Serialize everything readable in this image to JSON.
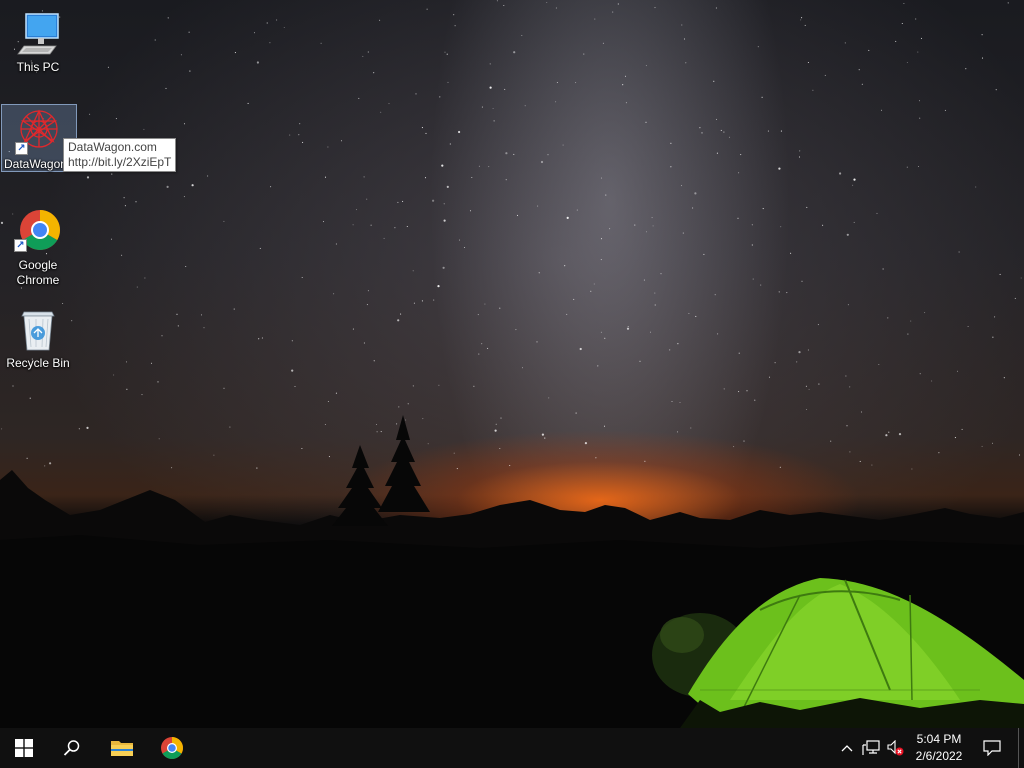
{
  "desktop": {
    "icons": [
      {
        "label": "This PC",
        "icon": "this-pc-icon"
      },
      {
        "label": "DataWagon",
        "icon": "datawagon-icon"
      },
      {
        "label": "Google Chrome",
        "icon": "chrome-icon"
      },
      {
        "label": "Recycle Bin",
        "icon": "recycle-bin-icon"
      }
    ],
    "tooltip": {
      "line1": "DataWagon.com",
      "line2": "http://bit.ly/2XziEpT"
    }
  },
  "taskbar": {
    "items": [
      {
        "name": "start",
        "icon": "windows-logo-icon"
      },
      {
        "name": "search",
        "icon": "search-icon"
      },
      {
        "name": "file-explorer",
        "icon": "folder-icon"
      },
      {
        "name": "chrome",
        "icon": "chrome-icon"
      }
    ],
    "tray": {
      "icons": [
        "chevron-up-icon",
        "network-icon",
        "speaker-muted-icon"
      ],
      "time": "5:04 PM",
      "date": "2/6/2022",
      "notifications_icon": "notification-icon"
    }
  },
  "colors": {
    "taskbar_bg": "#101010",
    "tent_green": "#7ed321",
    "chrome_red": "#db4437",
    "chrome_yellow": "#f4b400",
    "chrome_green": "#0f9d58",
    "chrome_blue": "#4285f4",
    "selection": "#7896be"
  }
}
